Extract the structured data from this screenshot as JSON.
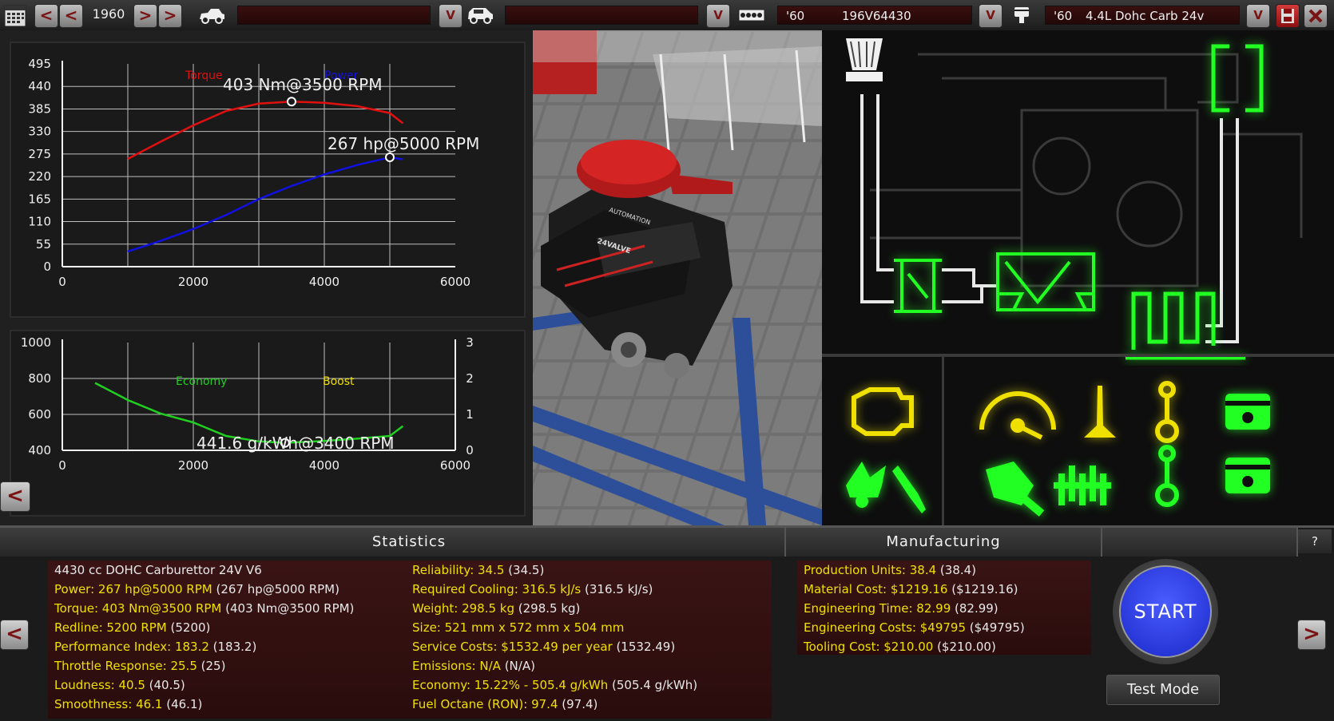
{
  "topbar": {
    "prev_fast_label": "<",
    "prev_label": "<",
    "year": "1960",
    "next_label": ">",
    "next_fast_label": ">",
    "chassis_field": "",
    "dropdown_label": "V",
    "trim_field": "",
    "family_year": "'60",
    "family_name": "196V64430",
    "variant_year": "'60",
    "variant_name": "4.4L Dohc Carb 24v"
  },
  "power_chart": {
    "legend_torque": "Torque",
    "legend_power": "Power",
    "y_ticks": [
      "495",
      "440",
      "385",
      "330",
      "275",
      "220",
      "165",
      "110",
      "55",
      "0"
    ],
    "x_ticks": [
      "0",
      "2000",
      "4000",
      "6000"
    ],
    "torque_annotation": "403 Nm@3500 RPM",
    "power_annotation": "267 hp@5000 RPM"
  },
  "economy_chart": {
    "legend_economy": "Economy",
    "legend_boost": "Boost",
    "y_ticks": [
      "1000",
      "800",
      "600",
      "400"
    ],
    "y2_ticks": [
      "3",
      "2",
      "1",
      "0"
    ],
    "x_ticks": [
      "0",
      "2000",
      "4000",
      "6000"
    ],
    "annotation": "441.6 g/kWh@3400 RPM"
  },
  "chart_data": [
    {
      "type": "line",
      "title": "",
      "xlabel": "",
      "ylabel": "",
      "xlim": [
        0,
        6000
      ],
      "ylim": [
        0,
        495
      ],
      "series": [
        {
          "name": "Torque",
          "color": "#e01010",
          "x": [
            1000,
            1500,
            2000,
            2500,
            3000,
            3500,
            4000,
            4500,
            5000,
            5200
          ],
          "y": [
            263,
            305,
            345,
            380,
            398,
            403,
            400,
            392,
            375,
            350
          ]
        },
        {
          "name": "Power",
          "color": "#1010e0",
          "x": [
            1000,
            1500,
            2000,
            2500,
            3000,
            3500,
            4000,
            4500,
            5000,
            5200
          ],
          "y": [
            37,
            63,
            92,
            126,
            165,
            197,
            225,
            248,
            267,
            262
          ]
        }
      ]
    },
    {
      "type": "line",
      "title": "",
      "xlabel": "",
      "ylabel": "",
      "xlim": [
        0,
        6000
      ],
      "ylim": [
        400,
        1000
      ],
      "series": [
        {
          "name": "Economy",
          "color": "#20d020",
          "x": [
            500,
            1000,
            1500,
            2000,
            2500,
            3000,
            3400,
            4000,
            4500,
            5000,
            5200
          ],
          "y": [
            775,
            680,
            605,
            555,
            480,
            450,
            441.6,
            452,
            465,
            480,
            535
          ]
        }
      ]
    }
  ],
  "statistics": {
    "title": "Statistics",
    "left": [
      {
        "k": "4430 cc DOHC Carburettor 24V V6",
        "v": ""
      },
      {
        "k": "Power: 267 hp@5000 RPM",
        "v": " (267 hp@5000 RPM)"
      },
      {
        "k": "Torque: 403 Nm@3500 RPM",
        "v": " (403 Nm@3500 RPM)"
      },
      {
        "k": "Redline: 5200 RPM",
        "v": " (5200)"
      },
      {
        "k": "Performance Index: 183.2",
        "v": " (183.2)"
      },
      {
        "k": "Throttle Response: 25.5",
        "v": " (25)"
      },
      {
        "k": "Loudness: 40.5",
        "v": " (40.5)"
      },
      {
        "k": "Smoothness: 46.1",
        "v": " (46.1)"
      }
    ],
    "right": [
      {
        "k": "Reliability: 34.5",
        "v": " (34.5)"
      },
      {
        "k": "Required Cooling: 316.5 kJ/s",
        "v": " (316.5 kJ/s)"
      },
      {
        "k": "Weight: 298.5 kg",
        "v": " (298.5 kg)"
      },
      {
        "k": "Size: 521 mm x 572 mm x 504 mm",
        "v": ""
      },
      {
        "k": "Service Costs: $1532.49 per year",
        "v": " (1532.49)"
      },
      {
        "k": "Emissions: N/A",
        "v": " (N/A)"
      },
      {
        "k": "Economy: 15.22% - 505.4 g/kWh",
        "v": " (505.4 g/kWh)"
      },
      {
        "k": "Fuel Octane (RON): 97.4",
        "v": " (97.4)"
      }
    ]
  },
  "manufacturing": {
    "title": "Manufacturing",
    "rows": [
      {
        "k": "Production Units: 38.4",
        "v": " (38.4)"
      },
      {
        "k": "Material Cost: $1219.16",
        "v": " ($1219.16)"
      },
      {
        "k": "Engineering Time: 82.99",
        "v": " (82.99)"
      },
      {
        "k": "Engineering Costs: $49795",
        "v": " ($49795)"
      },
      {
        "k": "Tooling Cost: $210.00",
        "v": " ($210.00)"
      }
    ]
  },
  "controls": {
    "help_label": "?",
    "start_label": "START",
    "test_mode_label": "Test Mode",
    "back_label": "<",
    "forward_label": ">"
  },
  "engine_render": {
    "cover_text_1": "AUTOMATION",
    "cover_text_2": "24VALVE"
  },
  "colors": {
    "accent_green": "#22ff22",
    "accent_yellow": "#f0e000",
    "start_blue": "#2a3cff"
  }
}
